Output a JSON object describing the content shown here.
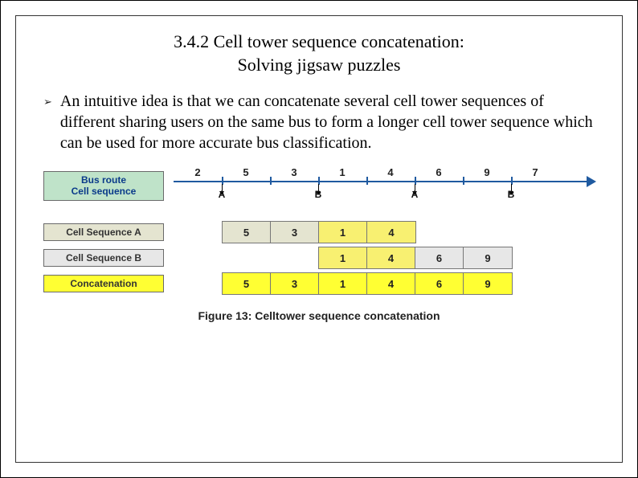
{
  "title_line1": "3.4.2 Cell tower sequence concatenation:",
  "title_line2": "Solving jigsaw puzzles",
  "bullet_text": "An intuitive idea is that we can concatenate several cell tower sequences of different sharing users on the same bus to form a longer cell tower sequence which can be used for more accurate bus classification.",
  "labels": {
    "busroute_l1": "Bus route",
    "busroute_l2": "Cell sequence",
    "seq_a": "Cell Sequence A",
    "seq_b": "Cell Sequence B",
    "concat": "Concatenation"
  },
  "bus_route_cells": [
    "2",
    "5",
    "3",
    "1",
    "4",
    "6",
    "9",
    "7"
  ],
  "markers": {
    "a1": "A",
    "b1": "B",
    "a2": "A",
    "b2": "B"
  },
  "seq_a_values": [
    "5",
    "3",
    "1",
    "4"
  ],
  "seq_b_values": [
    "1",
    "4",
    "6",
    "9"
  ],
  "concat_values": [
    "5",
    "3",
    "1",
    "4",
    "6",
    "9"
  ],
  "caption": "Figure 13: Celltower sequence concatenation"
}
